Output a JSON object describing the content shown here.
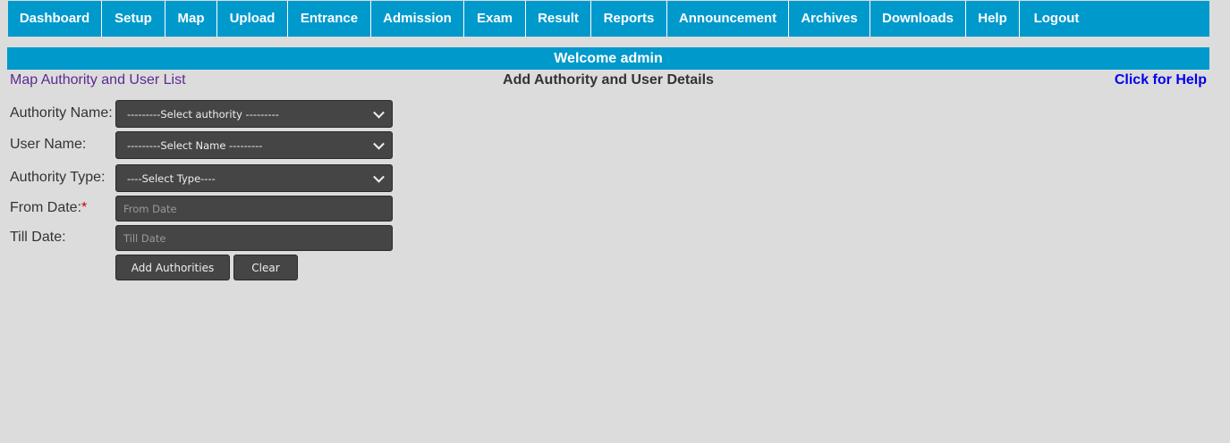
{
  "nav": [
    "Dashboard",
    "Setup",
    "Map",
    "Upload",
    "Entrance",
    "Admission",
    "Exam",
    "Result",
    "Reports",
    "Announcement",
    "Archives",
    "Downloads",
    "Help",
    "Logout"
  ],
  "welcome": "Welcome admin",
  "list_link": "Map Authority and User List",
  "title": "Add Authority and User Details",
  "help": "Click for Help",
  "form": {
    "authority_name": {
      "label": "Authority Name:",
      "value": "---------Select authority ---------"
    },
    "user_name": {
      "label": "User Name:",
      "value": "---------Select Name ---------"
    },
    "authority_type": {
      "label": "Authority Type:",
      "value": "----Select Type----"
    },
    "from_date": {
      "label": "From Date:",
      "required": "*",
      "placeholder": "From Date"
    },
    "till_date": {
      "label": "Till Date:",
      "placeholder": "Till Date"
    }
  },
  "buttons": {
    "add": "Add Authorities",
    "clear": "Clear"
  }
}
